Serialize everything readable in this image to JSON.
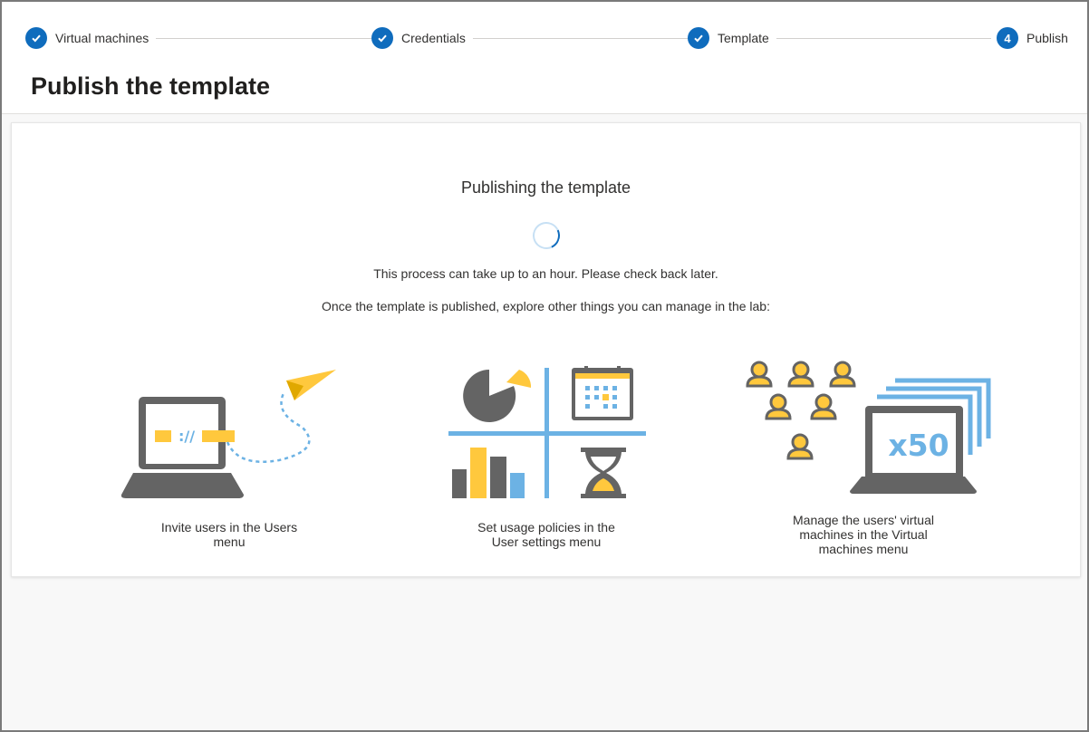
{
  "stepper": {
    "steps": [
      {
        "label": "Virtual machines",
        "state": "complete",
        "icon": "check-icon"
      },
      {
        "label": "Credentials",
        "state": "complete",
        "icon": "check-icon"
      },
      {
        "label": "Template",
        "state": "complete",
        "icon": "check-icon"
      },
      {
        "label": "Publish",
        "state": "current",
        "number": "4"
      }
    ]
  },
  "page": {
    "title": "Publish the template"
  },
  "publish": {
    "heading": "Publishing the template",
    "status_icon": "loading-spinner",
    "message": "This process can take up to an hour. Please check back later.",
    "explore": "Once the template is published, explore other things you can manage in the lab:"
  },
  "features": [
    {
      "caption": "Invite users in the Users menu",
      "icon": "laptop-paper-plane-illustration"
    },
    {
      "caption": "Set usage policies in the User settings menu",
      "icon": "usage-policies-illustration"
    },
    {
      "caption": "Manage the users' virtual machines in the Virtual machines menu",
      "icon": "users-vms-illustration",
      "badge": "x50"
    }
  ],
  "colors": {
    "accent": "#0f6cbd",
    "illustration_gray": "#646464",
    "illustration_yellow": "#ffc83d",
    "illustration_blue": "#6cb2e4"
  }
}
